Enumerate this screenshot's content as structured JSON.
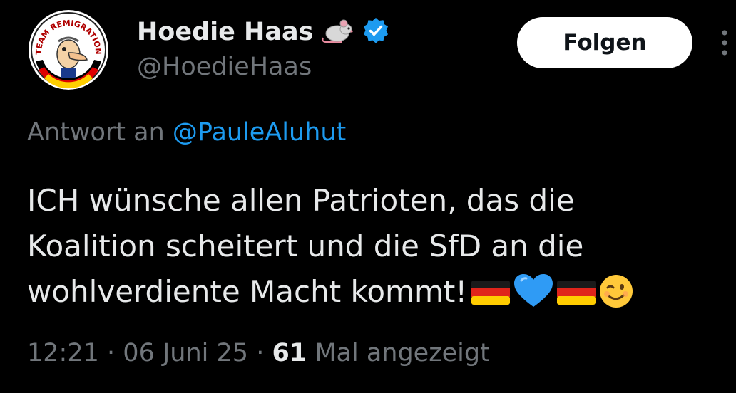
{
  "author": {
    "display_name": "Hoedie Haas",
    "handle": "@HoedieHaas",
    "name_emoji": "mouse-icon",
    "verified_badge": "verified-badge-icon",
    "avatar_text": "TEAM REMIGRATION"
  },
  "actions": {
    "follow_label": "Folgen",
    "more_icon": "more-options-icon"
  },
  "reply": {
    "prefix": "Antwort an",
    "mention": "@PauleAluhut"
  },
  "tweet": {
    "lines": [
      "ICH wünsche allen Patrioten, das die",
      "Koalition scheitert und die SfD an die",
      "wohlverdiente Macht kommt!"
    ],
    "emojis": [
      "german-flag-icon",
      "blue-heart-icon",
      "german-flag-icon",
      "winking-face-icon"
    ]
  },
  "meta": {
    "time": "12:21",
    "separator": "·",
    "date": "06 Juni 25",
    "views_count": "61",
    "views_label": "Mal angezeigt"
  },
  "colors": {
    "background": "#000000",
    "text_primary": "#e7e9ea",
    "text_secondary": "#71767b",
    "link": "#1d9bf0",
    "verified": "#1d9bf0"
  }
}
